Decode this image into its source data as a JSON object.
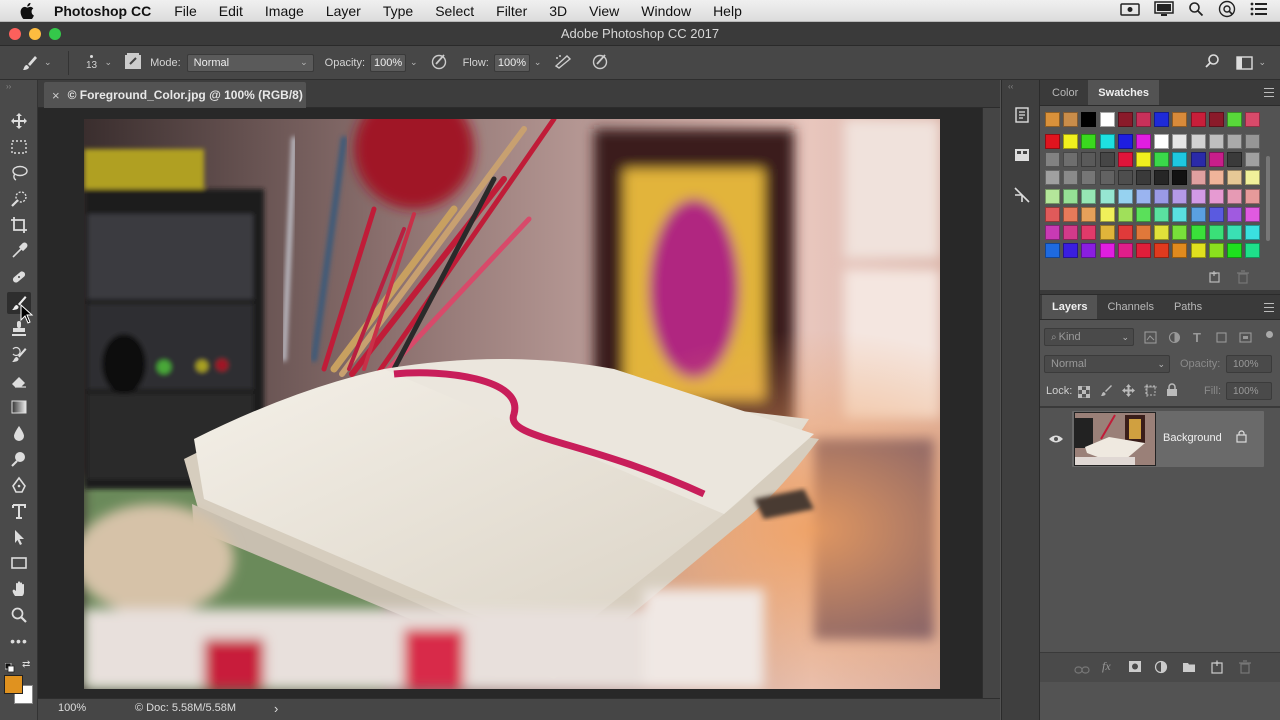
{
  "menubar": {
    "app": "Photoshop CC",
    "items": [
      "File",
      "Edit",
      "Image",
      "Layer",
      "Type",
      "Select",
      "Filter",
      "3D",
      "View",
      "Window",
      "Help"
    ]
  },
  "window": {
    "title": "Adobe Photoshop CC 2017"
  },
  "options": {
    "brush_size": "13",
    "mode_label": "Mode:",
    "mode_value": "Normal",
    "opacity_label": "Opacity:",
    "opacity_value": "100%",
    "flow_label": "Flow:",
    "flow_value": "100%"
  },
  "document": {
    "tab_title": "© Foreground_Color.jpg @ 100% (RGB/8)",
    "close": "×"
  },
  "status": {
    "zoom": "100%",
    "doc_info": "© Doc: 5.58M/5.58M",
    "arrow": "›"
  },
  "panels": {
    "color_tabs": [
      "Color",
      "Swatches"
    ],
    "active_color_tab": "Swatches",
    "layer_tabs": [
      "Layers",
      "Channels",
      "Paths"
    ],
    "active_layer_tab": "Layers",
    "kind_label": "Kind",
    "blend_mode": "Normal",
    "opacity_label": "Opacity:",
    "opacity_value": "100%",
    "lock_label": "Lock:",
    "fill_label": "Fill:",
    "fill_value": "100%",
    "layer_name": "Background"
  },
  "colors": {
    "foreground": "#e0921f",
    "background": "#ffffff",
    "swatch_rows": [
      [
        "#d9913a",
        "#c98d4a",
        "#000000",
        "#ffffff",
        "#8a1a2a",
        "#c8305a",
        "#1e2ad8",
        "#d88a3a",
        "#c81e3a",
        "#8a1a2a",
        "#58d83a",
        "#d84a6a"
      ],
      [
        "#e0141e",
        "#f0f01e",
        "#3ad81e",
        "#1ee0e0",
        "#1e1ee0",
        "#e01ee0",
        "#ffffff",
        "#e6e6e6",
        "#d2d2d2",
        "#bebebe",
        "#aaaaaa",
        "#969696"
      ],
      [
        "#828282",
        "#6e6e6e",
        "#5a5a5a",
        "#464646",
        "#e0143a",
        "#f0f01e",
        "#3ad84a",
        "#1ec8e0",
        "#2a2aa8",
        "#c81e8a",
        "#3a3a3a",
        "#a0a0a0"
      ],
      [
        "#a0a0a0",
        "#8a8a8a",
        "#767676",
        "#626262",
        "#4e4e4e",
        "#3a3a3a",
        "#262626",
        "#121212",
        "#e0a0a0",
        "#f0b49a",
        "#e6c896",
        "#f0f09a"
      ],
      [
        "#b4e69a",
        "#96e096",
        "#96e6b4",
        "#96e6d2",
        "#96d2f0",
        "#9ab4f0",
        "#9a9ae6",
        "#b49ae6",
        "#d29ae6",
        "#e69ad2",
        "#e69ab4",
        "#e69a9a"
      ],
      [
        "#e05a5a",
        "#e67a5a",
        "#e6a05a",
        "#f0f05a",
        "#a0e05a",
        "#5ae05a",
        "#5ae0a0",
        "#5ae0e0",
        "#5aa0e0",
        "#5a5ae0",
        "#a05ae0",
        "#e05ae0"
      ],
      [
        "#c83ab4",
        "#d23a8a",
        "#e03a6a",
        "#e0b43a",
        "#e03a3a",
        "#e0783a",
        "#e0e03a",
        "#78e03a",
        "#3ae03a",
        "#3ae078",
        "#3ae0b4",
        "#3ae0e0"
      ],
      [
        "#1e6ae0",
        "#3a1ee0",
        "#8a1ee0",
        "#e01ee0",
        "#e01e8a",
        "#e01e3a",
        "#e03a1e",
        "#e08a1e",
        "#e0e01e",
        "#8ae01e",
        "#1ee01e",
        "#1ee08a"
      ]
    ],
    "top_row": [
      "#d9913a",
      "#c98d4a",
      "#000000",
      "#ffffff",
      "#8a1a2a",
      "#c8305a",
      "#1e2ad8",
      "#d88a3a",
      "#c81e3a",
      "#8a1a2a",
      "#58d83a",
      "#d84a6a"
    ]
  }
}
